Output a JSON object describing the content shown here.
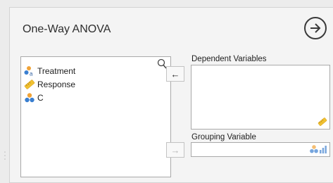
{
  "panel": {
    "title": "One-Way ANOVA",
    "run_icon": "arrow-right-circle-icon"
  },
  "variables": {
    "search_icon": "search-icon",
    "items": [
      {
        "label": "Treatment",
        "icon": "nominal-text-icon",
        "type": "nominal-text"
      },
      {
        "label": "Response",
        "icon": "scale-ruler-icon",
        "type": "scale"
      },
      {
        "label": "C",
        "icon": "nominal-icon",
        "type": "nominal"
      }
    ]
  },
  "buttons": {
    "move_dependent": "←",
    "move_grouping": "→"
  },
  "targets": {
    "dependent_label": "Dependent Variables",
    "grouping_label": "Grouping Variable"
  },
  "colors": {
    "nominal_orange": "#f0a338",
    "nominal_blue": "#3a7fd0",
    "scale_yellow": "#f1c232"
  }
}
